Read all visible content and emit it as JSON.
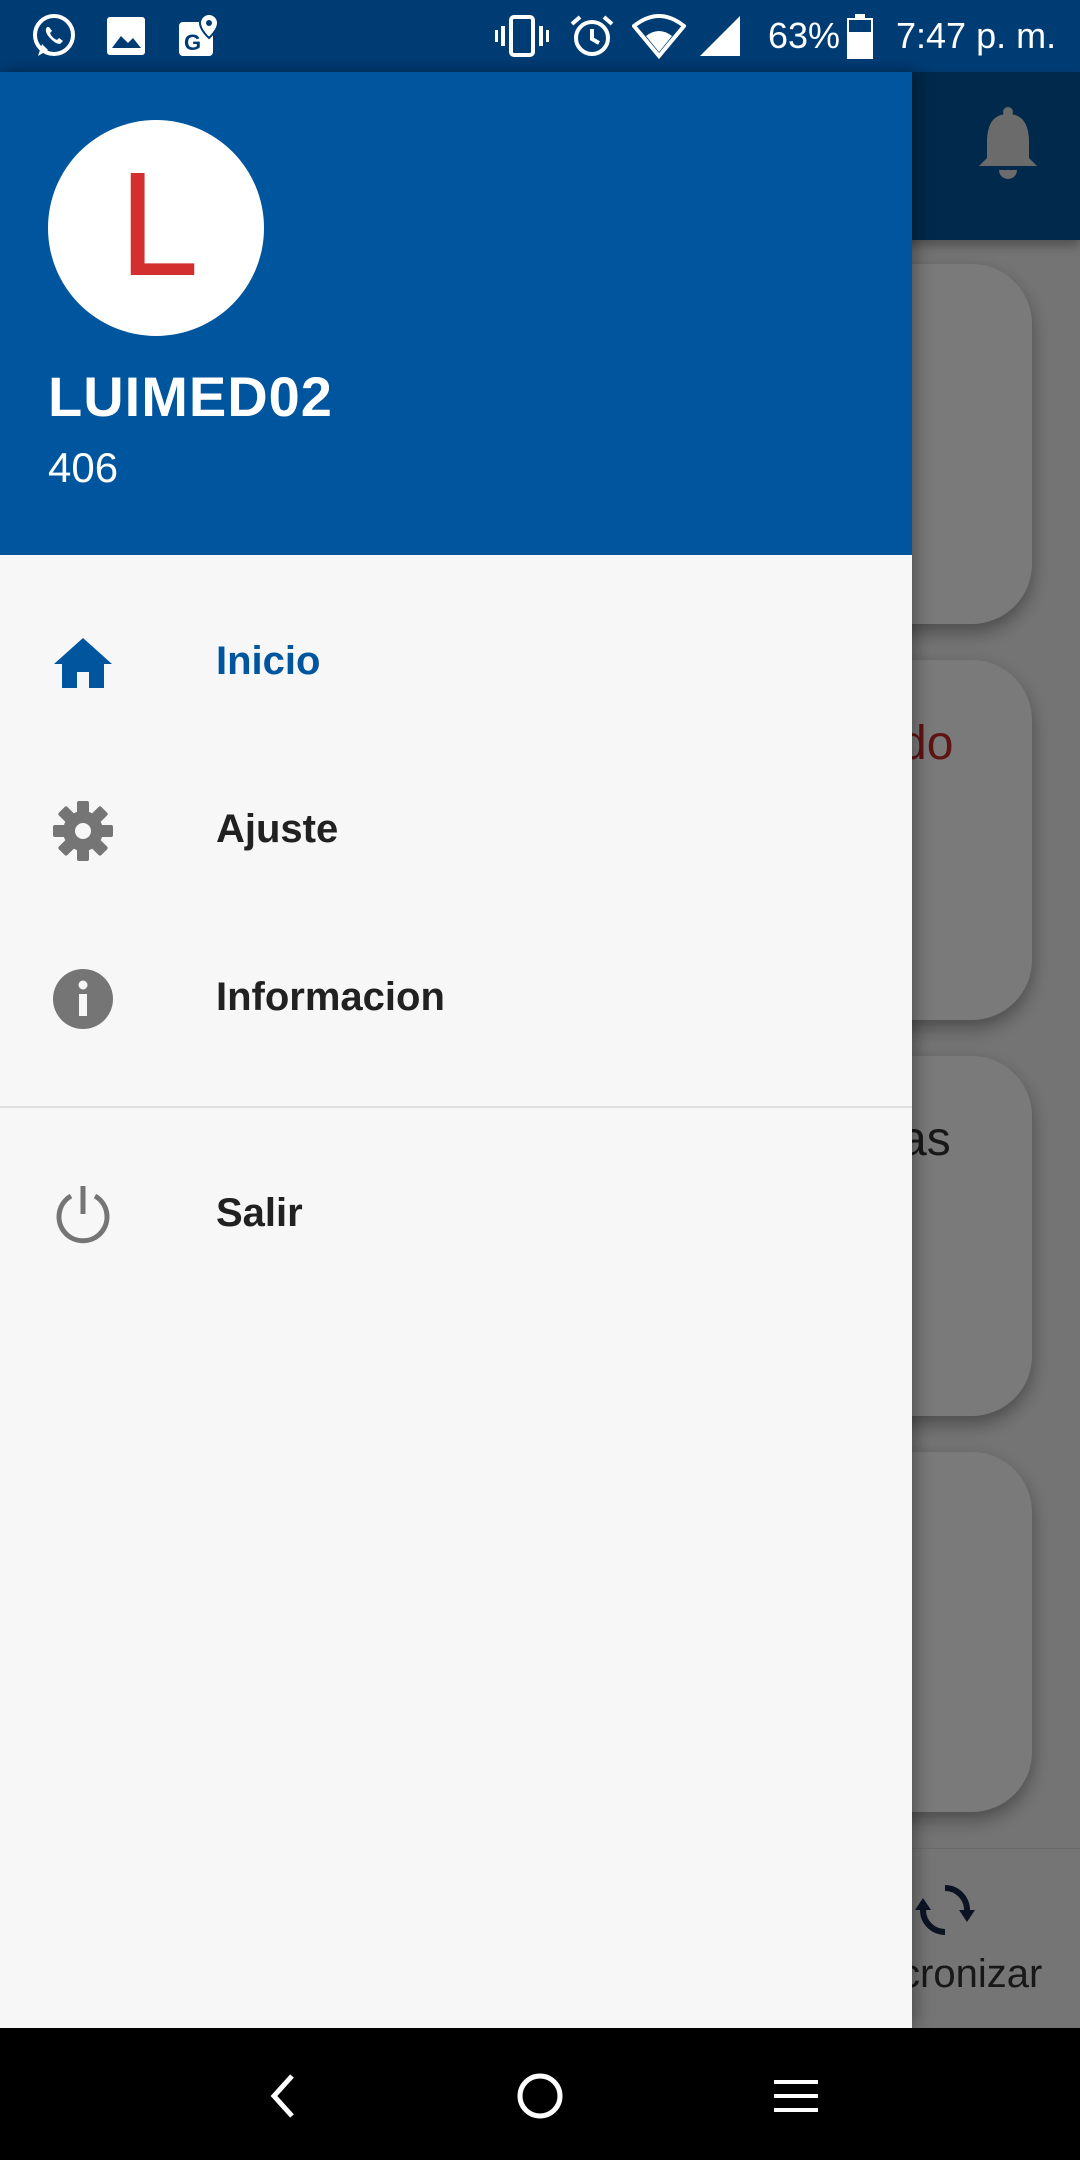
{
  "status_bar": {
    "battery": "63%",
    "time": "7:47 p. m.",
    "icons": [
      "whatsapp-icon",
      "gallery-icon",
      "maps-icon",
      "vibrate-icon",
      "alarm-icon",
      "wifi-icon",
      "signal-icon",
      "battery-icon"
    ]
  },
  "drawer": {
    "avatar_letter": "L",
    "user_name": "LUIMED02",
    "user_id": "406",
    "items": [
      {
        "label": "Inicio",
        "icon": "home-icon",
        "active": true
      },
      {
        "label": "Ajuste",
        "icon": "gear-icon",
        "active": false
      },
      {
        "label": "Informacion",
        "icon": "info-icon",
        "active": false
      },
      {
        "label": "Salir",
        "icon": "power-icon",
        "active": false
      }
    ]
  },
  "background": {
    "card_fragments": [
      "do",
      "as"
    ],
    "sync_label": "cronizar"
  },
  "colors": {
    "primary": "#00569e",
    "status_bar": "#003c74",
    "avatar_letter": "#d32f2f",
    "icon_gray": "#757575"
  }
}
